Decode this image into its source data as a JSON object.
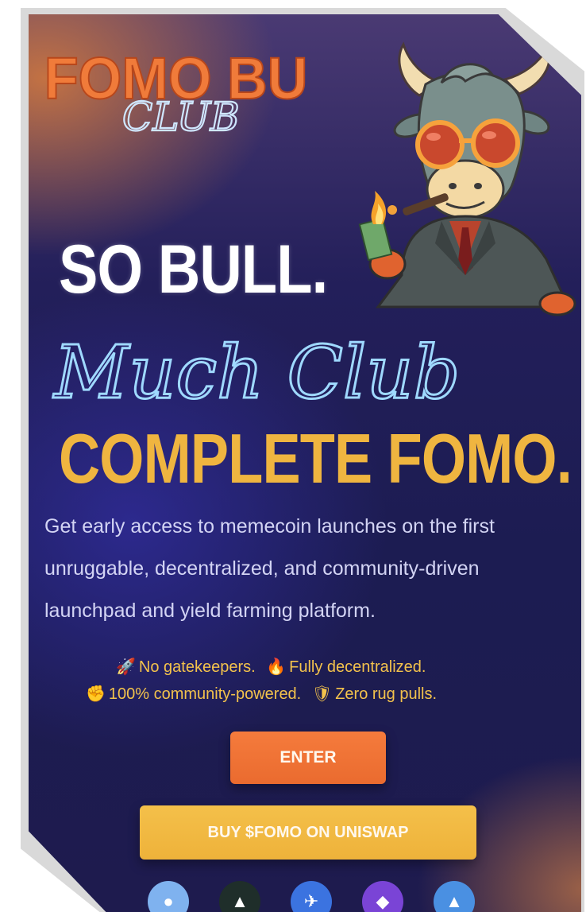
{
  "brand": {
    "logo_top": "FOMO BULL",
    "logo_bottom": "CLUB"
  },
  "hero": {
    "headline_1": "SO BULL.",
    "headline_script": "Much Club",
    "headline_2": "COMPLETE FOMO.",
    "description": "Get early access to memecoin launches on the first unruggable, decentralized, and community-driven launchpad and yield farming platform."
  },
  "features": [
    {
      "icon": "rocket-icon",
      "glyph": "🚀",
      "text": "No gatekeepers."
    },
    {
      "icon": "flame-icon",
      "glyph": "🔥",
      "text": "Fully decentralized."
    },
    {
      "icon": "fist-icon",
      "glyph": "✊",
      "text": "100% community-powered."
    },
    {
      "icon": "shield-icon",
      "glyph": "🛡",
      "text": "Zero rug pulls."
    }
  ],
  "buttons": {
    "enter": "ENTER",
    "buy": "BUY $FOMO ON UNISWAP"
  },
  "socials": [
    {
      "name": "social-icon-1",
      "color": "#7fb2ef"
    },
    {
      "name": "social-icon-2",
      "color": "#1f2e2a"
    },
    {
      "name": "social-icon-3",
      "color": "#3b73e0"
    },
    {
      "name": "social-icon-4",
      "color": "#7a44d6"
    },
    {
      "name": "social-icon-5",
      "color": "#4a90e2"
    }
  ],
  "colors": {
    "accent_orange": "#ea6b2f",
    "accent_gold": "#efb540",
    "neon_blue": "#9fd9ff",
    "bg_navy": "#1c1c52"
  }
}
